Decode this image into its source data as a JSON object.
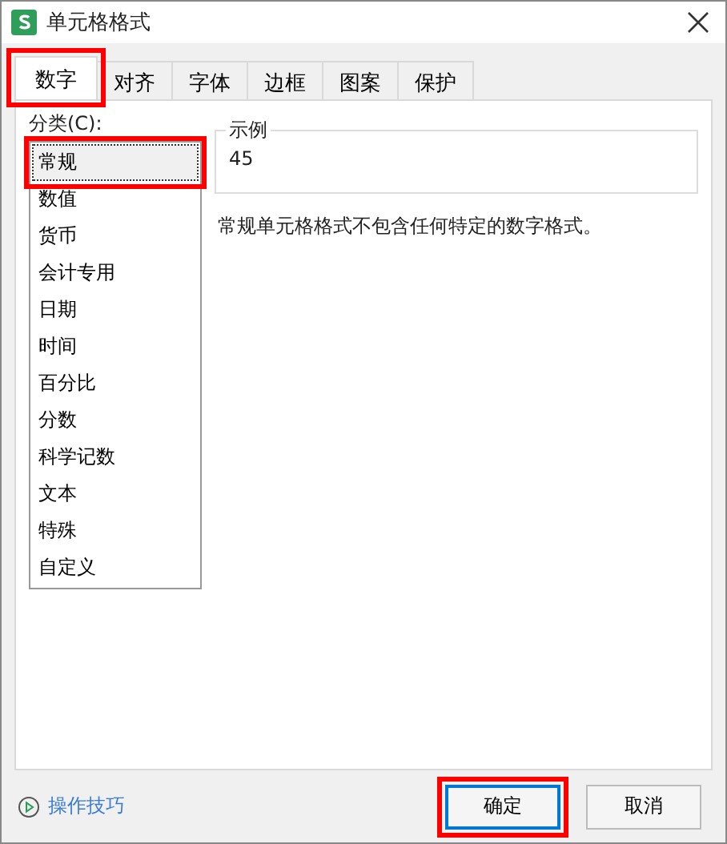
{
  "window": {
    "title": "单元格格式"
  },
  "tabs": [
    {
      "label": "数字",
      "selected": true,
      "highlighted": true
    },
    {
      "label": "对齐",
      "selected": false,
      "highlighted": false
    },
    {
      "label": "字体",
      "selected": false,
      "highlighted": false
    },
    {
      "label": "边框",
      "selected": false,
      "highlighted": false
    },
    {
      "label": "图案",
      "selected": false,
      "highlighted": false
    },
    {
      "label": "保护",
      "selected": false,
      "highlighted": false
    }
  ],
  "category": {
    "label": "分类(C):",
    "items": [
      {
        "label": "常规",
        "selected": true,
        "highlighted": true
      },
      {
        "label": "数值",
        "selected": false,
        "highlighted": false
      },
      {
        "label": "货币",
        "selected": false,
        "highlighted": false
      },
      {
        "label": "会计专用",
        "selected": false,
        "highlighted": false
      },
      {
        "label": "日期",
        "selected": false,
        "highlighted": false
      },
      {
        "label": "时间",
        "selected": false,
        "highlighted": false
      },
      {
        "label": "百分比",
        "selected": false,
        "highlighted": false
      },
      {
        "label": "分数",
        "selected": false,
        "highlighted": false
      },
      {
        "label": "科学记数",
        "selected": false,
        "highlighted": false
      },
      {
        "label": "文本",
        "selected": false,
        "highlighted": false
      },
      {
        "label": "特殊",
        "selected": false,
        "highlighted": false
      },
      {
        "label": "自定义",
        "selected": false,
        "highlighted": false
      }
    ]
  },
  "sample": {
    "label": "示例",
    "value": "45"
  },
  "description": "常规单元格格式不包含任何特定的数字格式。",
  "footer": {
    "tips_link": "操作技巧",
    "buttons": [
      {
        "label": "确定",
        "default": true,
        "highlighted": true
      },
      {
        "label": "取消",
        "default": false,
        "highlighted": false
      }
    ]
  }
}
